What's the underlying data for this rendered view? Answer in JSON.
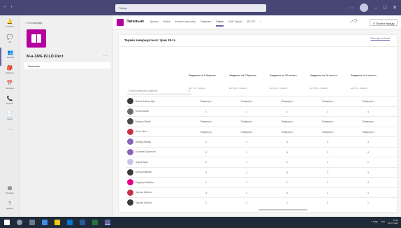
{
  "titlebar": {
    "back": "‹",
    "forward": "›",
    "search_placeholder": "Пошук",
    "more": "···",
    "minimize": "–",
    "maximize": "□",
    "close": "✕"
  },
  "rail": {
    "items": [
      {
        "icon": "🔔",
        "label": "Активність"
      },
      {
        "icon": "💬",
        "label": "Чат"
      },
      {
        "icon": "👥",
        "label": "Команди"
      },
      {
        "icon": "🎒",
        "label": "Завдання"
      },
      {
        "icon": "📅",
        "label": "Календар"
      },
      {
        "icon": "📞",
        "label": "Виклики"
      },
      {
        "icon": "📄",
        "label": "Файли"
      },
      {
        "icon": "···",
        "label": ""
      }
    ],
    "bottom": [
      {
        "icon": "▦",
        "label": "Програми"
      },
      {
        "icon": "?",
        "label": "Довідка"
      }
    ]
  },
  "teampanel": {
    "back_label": "‹ Усі команди",
    "team_name": "M-a-18/6-19.LD.Ukr.t",
    "more": "···",
    "channel": "Загальне"
  },
  "channel": {
    "name": "Загальне",
    "tabs": [
      "Дописи",
      "Файли",
      "Блокнот для класу",
      "Завдання",
      "Оцінки",
      "Сайт \"Група\"",
      "ВСТУП",
      "+"
    ],
    "active_tab": 4,
    "tools": "⤢  ⟳",
    "meet_label": "⊙ Почати нараду"
  },
  "sheet": {
    "period": "Термін завершується: трав 18-та",
    "export": "Експорт в Excel",
    "search_placeholder": "Пошук учнів або студентів",
    "search_icon": "search-icon",
    "columns": [
      {
        "title": "Завдання на 9 березня",
        "sub": "квіт 7-го - Оцінити..."
      },
      {
        "title": "Завдання на 2 березня",
        "sub": "квіт 30-го - Оцінити..."
      },
      {
        "title": "Завдання на 23 лютого",
        "sub": "квіт 22-го - Оцінити..."
      },
      {
        "title": "Завдання на 16 лютого",
        "sub": "квіт 15-го - Оцінити..."
      },
      {
        "title": "Завдання на 9 лютого",
        "sub": "квіт 8-го - Оцінити..."
      }
    ],
    "rows": [
      {
        "name": "Bobas Andrey Ajin",
        "avatar": "#3b3a39",
        "cells": [
          "Повернуто",
          "Повернуто",
          "Повернуто",
          "Повернуто",
          "Повернуто"
        ]
      },
      {
        "name": "Котик Міхей",
        "avatar": "#6b6a69",
        "cells": [
          "1",
          "1",
          "1",
          "1",
          "4"
        ]
      },
      {
        "name": "Макуха Міхей",
        "avatar": "#4a4948",
        "cells": [
          "Повернуто",
          "Повернуто",
          "Повернуто",
          "Повернуто",
          "Повернуто"
        ]
      },
      {
        "name": "Алес Ганя",
        "avatar": "#c4314b",
        "cells": [
          "Повернуто",
          "Повернуто",
          "Повернуто",
          "Повернуто",
          "Повернуто"
        ]
      },
      {
        "name": "Аніхад Аніхад",
        "avatar": "#8764b8",
        "cells": [
          "2",
          "1",
          "4",
          "3",
          "4"
        ]
      },
      {
        "name": "Базелгач Гранолог",
        "avatar": "#8764b8",
        "cells": [
          "3",
          "1",
          "4",
          "3",
          "4"
        ]
      },
      {
        "name": "Чирок Ванн",
        "avatar": "#c8c6e8",
        "cells": [
          "1",
          "1",
          "1",
          "1",
          "1"
        ]
      },
      {
        "name": "Мегуш Вабхав",
        "avatar": "#3b3a39",
        "cells": [
          "3",
          "1",
          "3",
          "3",
          "3"
        ]
      },
      {
        "name": "Радимук Вавбан",
        "avatar": "#e3008c",
        "cells": [
          "1",
          "1",
          "1",
          "1",
          "4"
        ]
      },
      {
        "name": "Чирчек Абасон",
        "avatar": "#c4314b",
        "cells": [
          "3",
          "1",
          "4",
          "1",
          "4"
        ]
      },
      {
        "name": "Чирчек Абасон",
        "avatar": "#3b3a39",
        "cells": [
          "1",
          "1",
          "1",
          "1",
          "1"
        ]
      }
    ]
  },
  "taskbar": {
    "clock_time": "19:21",
    "clock_date": "21.07.2021",
    "lang": "УКР"
  }
}
